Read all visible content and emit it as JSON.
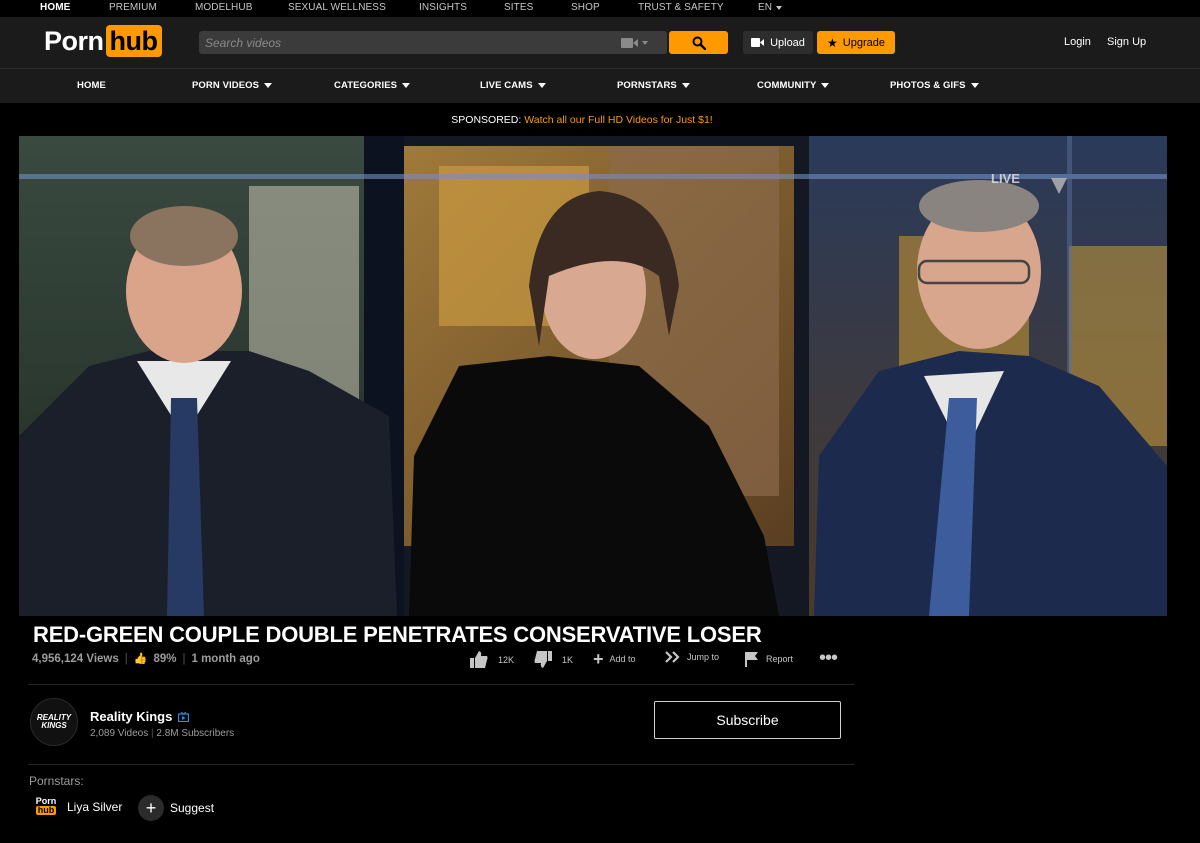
{
  "top_nav": {
    "items": [
      "HOME",
      "PREMIUM",
      "MODELHUB",
      "SEXUAL WELLNESS",
      "INSIGHTS",
      "SITES",
      "SHOP",
      "TRUST & SAFETY",
      "EN"
    ]
  },
  "header": {
    "logo_porn": "Porn",
    "logo_hub": "hub",
    "search_placeholder": "Search videos",
    "upload_label": "Upload",
    "upgrade_label": "Upgrade",
    "login_label": "Login",
    "signup_label": "Sign Up"
  },
  "main_nav": {
    "items": [
      "HOME",
      "PORN VIDEOS",
      "CATEGORIES",
      "LIVE CAMS",
      "PORNSTARS",
      "COMMUNITY",
      "PHOTOS & GIFS"
    ]
  },
  "sponsored": {
    "label": "SPONSORED:",
    "link_text": "Watch all our Full HD Videos for Just $1!"
  },
  "player": {
    "live_badge": "LIVE"
  },
  "video": {
    "title": "RED-GREEN COUPLE DOUBLE PENETRATES CONSERVATIVE LOSER",
    "views": "4,956,124 Views",
    "rating": "89%",
    "age": "1 month ago"
  },
  "actions": {
    "likes": "12K",
    "dislikes": "1K",
    "add_to": "Add to",
    "jump_to": "Jump to",
    "report": "Report"
  },
  "channel": {
    "logo_line1": "REALITY",
    "logo_line2": "KINGS",
    "name": "Reality Kings",
    "videos": "2,089 Videos",
    "subscribers": "2.8M Subscribers",
    "subscribe_label": "Subscribe"
  },
  "pornstars": {
    "label": "Pornstars:",
    "badge_porn": "Porn",
    "badge_hub": "hub",
    "name": "Liya Silver",
    "suggest_label": "Suggest"
  },
  "colors": {
    "accent": "#ff9900",
    "header_bg": "#1b1b1b",
    "page_bg": "#000000"
  }
}
